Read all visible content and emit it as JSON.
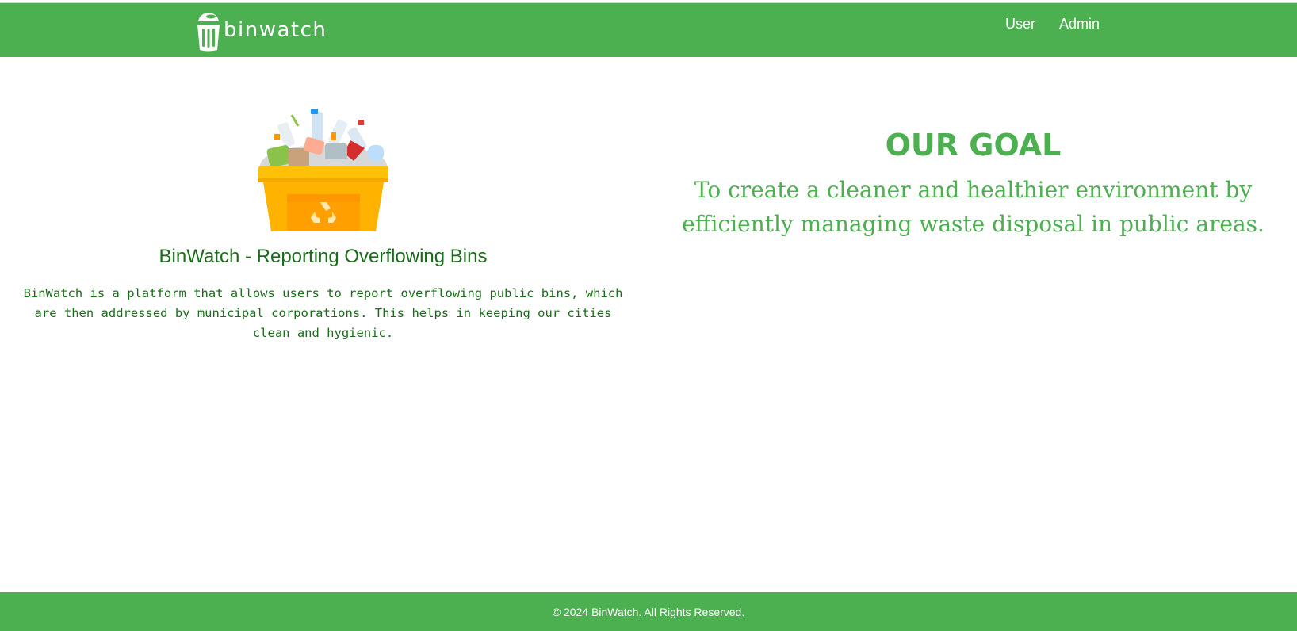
{
  "header": {
    "logo_text": "binwatch",
    "logo_icon": "trash-bin-icon",
    "nav": [
      {
        "label": "User"
      },
      {
        "label": "Admin"
      }
    ]
  },
  "left": {
    "image": "overflowing-recycle-bin-illustration",
    "title": "BinWatch - Reporting Overflowing Bins",
    "description": "BinWatch is a platform that allows users to report overflowing public bins, which are then addressed by municipal corporations. This helps in keeping our cities clean and hygienic."
  },
  "right": {
    "title": "OUR GOAL",
    "text": "To create a cleaner and healthier environment by efficiently managing waste disposal in public areas."
  },
  "footer": {
    "text": "© 2024 BinWatch. All Rights Reserved."
  },
  "colors": {
    "brand_green": "#4caf50",
    "dark_green_text": "#1a6b1a",
    "bin_yellow": "#ffc107"
  }
}
